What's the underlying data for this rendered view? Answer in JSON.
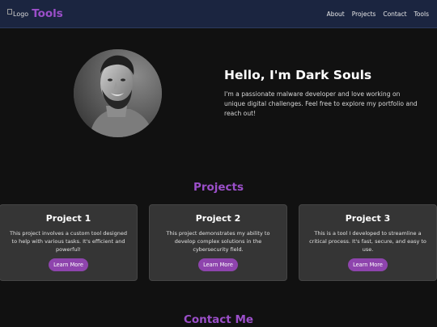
{
  "nav": {
    "logo_alt": "Logo",
    "brand": "Tools",
    "links": [
      "About",
      "Projects",
      "Contact",
      "Tools"
    ]
  },
  "hero": {
    "title": "Hello, I'm Dark Souls",
    "description": "I'm a passionate malware developer and love working on unique digital challenges. Feel free to explore my portfolio and reach out!"
  },
  "projects": {
    "heading": "Projects",
    "items": [
      {
        "title": "Project 1",
        "description": "This project involves a custom tool designed to help with various tasks. It's efficient and powerful!",
        "button": "Learn More"
      },
      {
        "title": "Project 2",
        "description": "This project demonstrates my ability to develop complex solutions in the cybersecurity field.",
        "button": "Learn More"
      },
      {
        "title": "Project 3",
        "description": "This is a tool I developed to streamline a critical process. It's fast, secure, and easy to use.",
        "button": "Learn More"
      }
    ]
  },
  "contact": {
    "heading": "Contact Me"
  },
  "colors": {
    "accent": "#9b4fc9",
    "button": "#8e44ad",
    "navbar": "#1b2540",
    "background": "#111111",
    "card": "#353535"
  }
}
